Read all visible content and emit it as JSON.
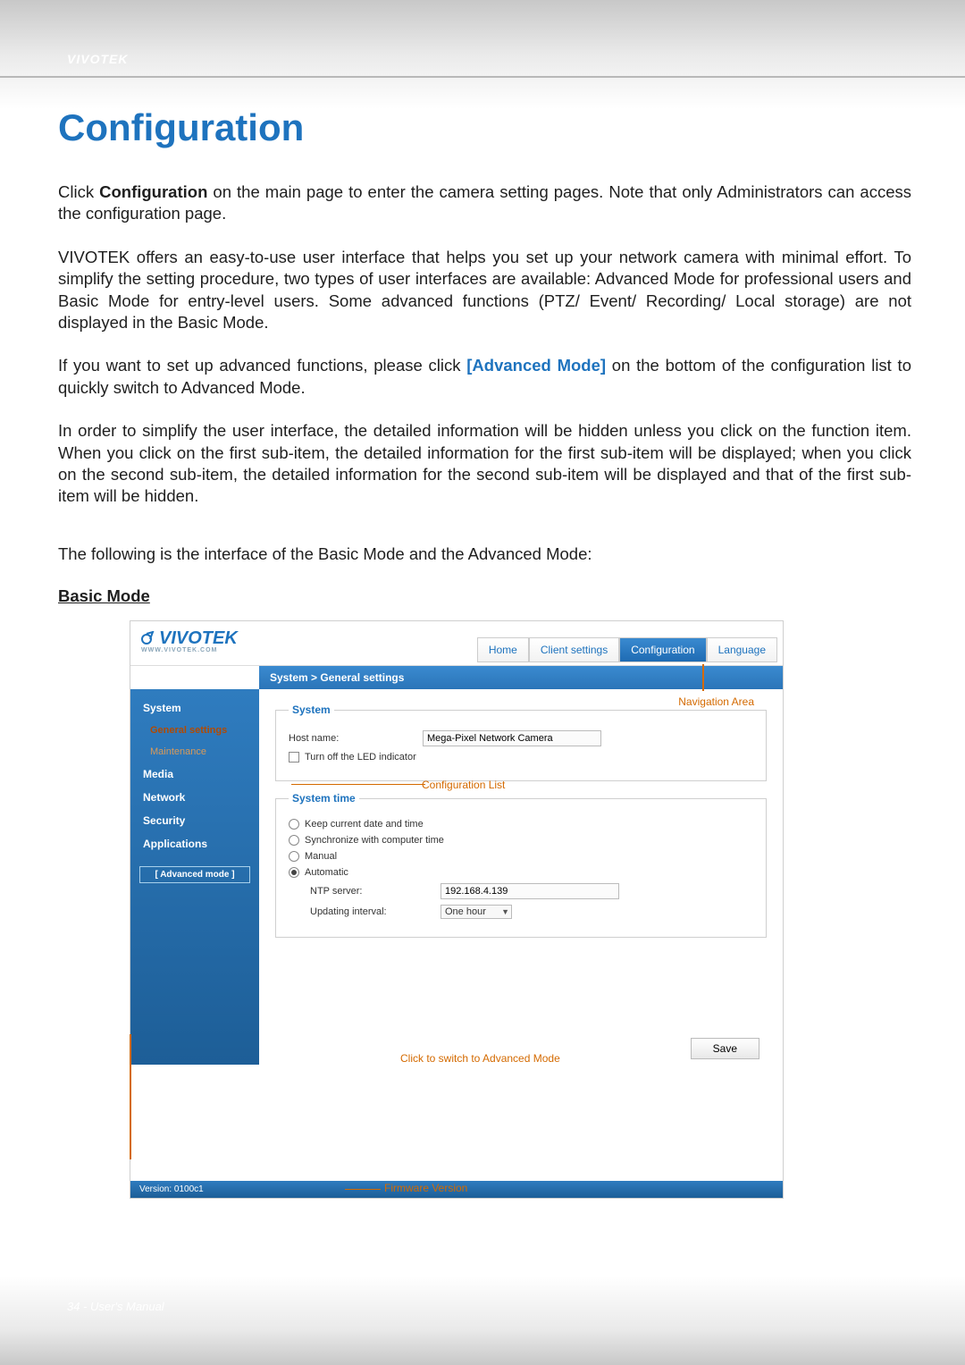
{
  "brand": "VIVOTEK",
  "doc": {
    "title": "Configuration",
    "p1a": "Click ",
    "p1b": "Configuration",
    "p1c": " on the main page to enter the camera setting pages. Note that only Administrators can access the configuration page.",
    "p2": "VIVOTEK offers an easy-to-use user interface that helps you set up your network camera with minimal effort. To simplify the setting procedure, two types of user interfaces are available: Advanced Mode for professional users and Basic Mode for entry-level users. Some advanced functions (PTZ/ Event/ Recording/ Local storage) are not displayed in the Basic Mode.",
    "p3a": "If you want to set up advanced functions, please click ",
    "p3b": "[Advanced Mode]",
    "p3c": " on the bottom of the configuration list to quickly switch to Advanced Mode.",
    "p4": "In order to simplify the user interface, the detailed information will be hidden unless you click on the function item. When you click on the first sub-item, the detailed information for the first sub-item will be displayed; when you click on the second sub-item, the detailed information for the second sub-item will be displayed and that of the first sub-item will be hidden.",
    "p5": "The following is the interface of the Basic Mode and the Advanced Mode:",
    "basic_mode_heading": "Basic Mode"
  },
  "shot": {
    "logo": "VIVOTEK",
    "logo_sub": "WWW.VIVOTEK.COM",
    "tabs": {
      "home": "Home",
      "client": "Client settings",
      "config": "Configuration",
      "lang": "Language"
    },
    "breadcrumb": "System  >  General settings",
    "sidebar": {
      "system": "System",
      "general": "General settings",
      "maintenance": "Maintenance",
      "media": "Media",
      "network": "Network",
      "security": "Security",
      "applications": "Applications",
      "advanced": "[ Advanced mode ]"
    },
    "system_group": {
      "legend": "System",
      "hostname_label": "Host name:",
      "hostname_value": "Mega-Pixel Network Camera",
      "led_label": "Turn off the LED indicator"
    },
    "time_group": {
      "legend": "System time",
      "keep": "Keep current date and time",
      "sync": "Synchronize with computer time",
      "manual": "Manual",
      "auto": "Automatic",
      "ntp_label": "NTP server:",
      "ntp_value": "192.168.4.139",
      "interval_label": "Updating interval:",
      "interval_value": "One hour"
    },
    "save": "Save",
    "version": "Version: 0100c1"
  },
  "callouts": {
    "nav_area": "Navigation Area",
    "config_list": "Configuration List",
    "adv_switch": "Click to switch to Advanced Mode",
    "fw": "Firmware Version"
  },
  "footer": "34 - User's Manual"
}
